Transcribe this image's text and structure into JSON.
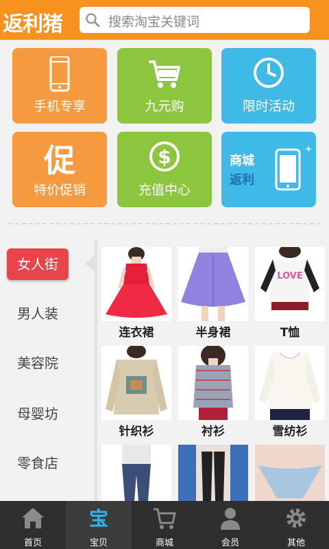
{
  "header": {
    "logo": "返利猪",
    "search_placeholder": "搜索淘宝关键词"
  },
  "tiles": [
    {
      "label": "手机专享",
      "icon": "phone-icon",
      "color": "#f59a3e"
    },
    {
      "label": "九元购",
      "icon": "cart-icon",
      "color": "#8cc63f"
    },
    {
      "label": "限时活动",
      "icon": "clock-icon",
      "color": "#3fb9e5"
    },
    {
      "label": "特价促销",
      "icon": "promo-icon",
      "glyph": "促",
      "color": "#f59a3e"
    },
    {
      "label": "充值中心",
      "icon": "dollar-icon",
      "color": "#8cc63f"
    },
    {
      "label": "商城",
      "label2": "返利",
      "icon": "phone-icon",
      "color": "#3fb9e5"
    }
  ],
  "sidebar": {
    "items": [
      "女人街",
      "男人装",
      "美容院",
      "母婴坊",
      "零食店"
    ],
    "active": "女人街"
  },
  "products": [
    {
      "caption": "连衣裙"
    },
    {
      "caption": "半身裙"
    },
    {
      "caption": "T恤"
    },
    {
      "caption": "针织衫"
    },
    {
      "caption": "衬衫"
    },
    {
      "caption": "雪纺衫"
    },
    {
      "caption": ""
    },
    {
      "caption": ""
    },
    {
      "caption": ""
    }
  ],
  "bottom_nav": [
    {
      "label": "首页",
      "icon": "home-icon"
    },
    {
      "label": "宝贝",
      "icon": "treasure-icon",
      "glyph": "宝",
      "active": true
    },
    {
      "label": "商城",
      "icon": "cart-icon"
    },
    {
      "label": "会员",
      "icon": "user-icon"
    },
    {
      "label": "其他",
      "icon": "gear-icon"
    }
  ]
}
